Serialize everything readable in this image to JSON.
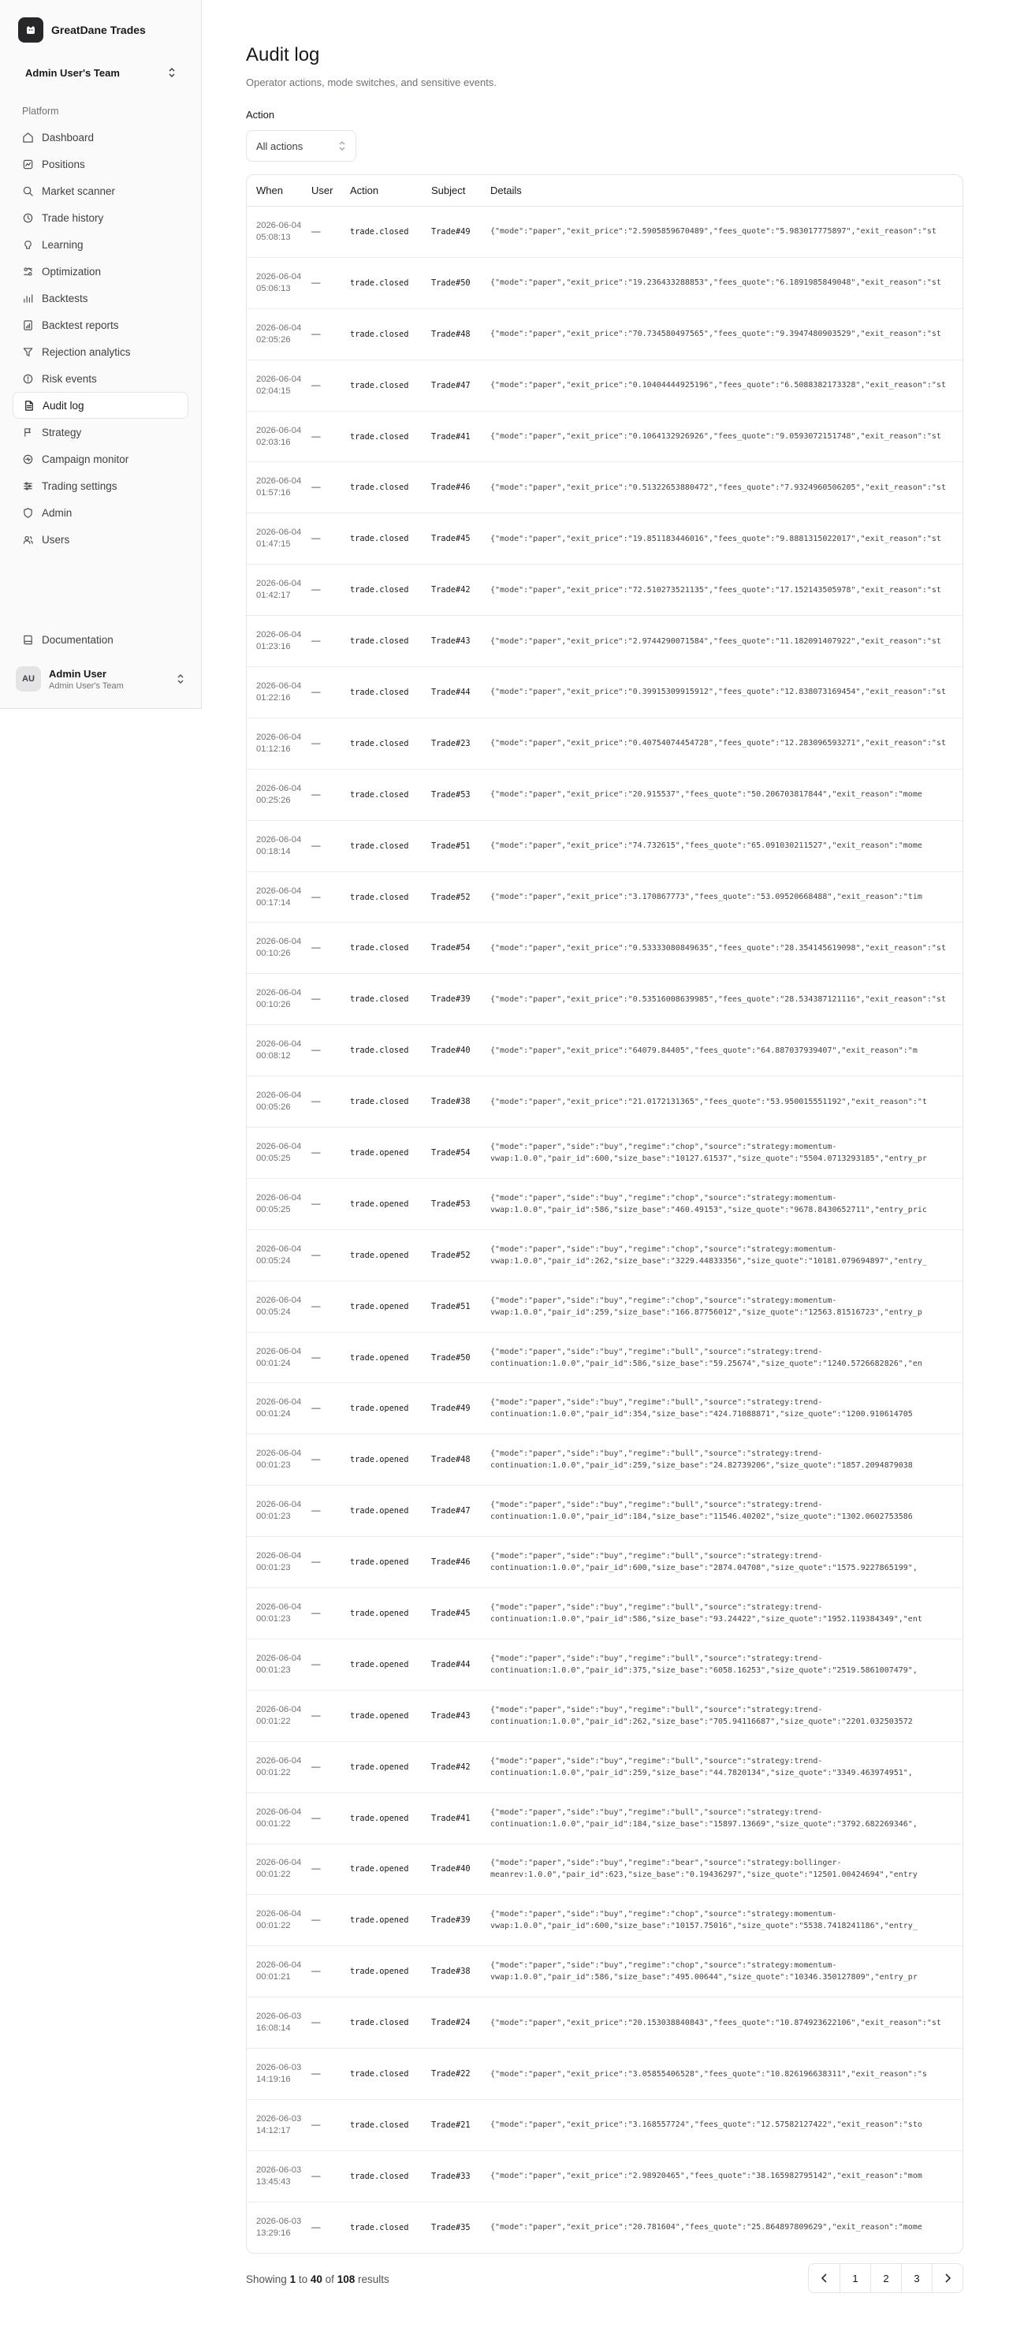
{
  "app": {
    "name": "GreatDane Trades",
    "team": "Admin User's Team"
  },
  "sidebar": {
    "section": "Platform",
    "items": [
      {
        "label": "Dashboard",
        "icon": "dashboard-icon",
        "active": false
      },
      {
        "label": "Positions",
        "icon": "positions-icon",
        "active": false
      },
      {
        "label": "Market scanner",
        "icon": "search-icon",
        "active": false
      },
      {
        "label": "Trade history",
        "icon": "history-icon",
        "active": false
      },
      {
        "label": "Learning",
        "icon": "learning-icon",
        "active": false
      },
      {
        "label": "Optimization",
        "icon": "optimization-icon",
        "active": false
      },
      {
        "label": "Backtests",
        "icon": "bar-chart-icon",
        "active": false
      },
      {
        "label": "Backtest reports",
        "icon": "report-icon",
        "active": false
      },
      {
        "label": "Rejection analytics",
        "icon": "filter-icon",
        "active": false
      },
      {
        "label": "Risk events",
        "icon": "alert-icon",
        "active": false
      },
      {
        "label": "Audit log",
        "icon": "document-icon",
        "active": true
      },
      {
        "label": "Strategy",
        "icon": "strategy-icon",
        "active": false
      },
      {
        "label": "Campaign monitor",
        "icon": "monitor-icon",
        "active": false
      },
      {
        "label": "Trading settings",
        "icon": "sliders-icon",
        "active": false
      },
      {
        "label": "Admin",
        "icon": "shield-icon",
        "active": false
      },
      {
        "label": "Users",
        "icon": "users-icon",
        "active": false
      }
    ],
    "documentation": "Documentation",
    "user": {
      "initials": "AU",
      "name": "Admin User",
      "team": "Admin User's Team"
    }
  },
  "page": {
    "title": "Audit log",
    "subtitle": "Operator actions, mode switches, and sensitive events.",
    "filter_label": "Action",
    "filter_value": "All actions"
  },
  "table": {
    "headers": {
      "when": "When",
      "user": "User",
      "action": "Action",
      "subject": "Subject",
      "details": "Details"
    },
    "rows": [
      {
        "date": "2026-06-04",
        "time": "05:08:13",
        "user": "—",
        "action": "trade.closed",
        "subject": "Trade#49",
        "details": [
          "{\"mode\":\"paper\",\"exit_price\":\"2.5905859670489\",\"fees_quote\":\"5.983017775897\",\"exit_reason\":\"st"
        ]
      },
      {
        "date": "2026-06-04",
        "time": "05:06:13",
        "user": "—",
        "action": "trade.closed",
        "subject": "Trade#50",
        "details": [
          "{\"mode\":\"paper\",\"exit_price\":\"19.236433288853\",\"fees_quote\":\"6.1891985849048\",\"exit_reason\":\"st"
        ]
      },
      {
        "date": "2026-06-04",
        "time": "02:05:26",
        "user": "—",
        "action": "trade.closed",
        "subject": "Trade#48",
        "details": [
          "{\"mode\":\"paper\",\"exit_price\":\"70.734580497565\",\"fees_quote\":\"9.3947480903529\",\"exit_reason\":\"st"
        ]
      },
      {
        "date": "2026-06-04",
        "time": "02:04:15",
        "user": "—",
        "action": "trade.closed",
        "subject": "Trade#47",
        "details": [
          "{\"mode\":\"paper\",\"exit_price\":\"0.10404444925196\",\"fees_quote\":\"6.5088382173328\",\"exit_reason\":\"st"
        ]
      },
      {
        "date": "2026-06-04",
        "time": "02:03:16",
        "user": "—",
        "action": "trade.closed",
        "subject": "Trade#41",
        "details": [
          "{\"mode\":\"paper\",\"exit_price\":\"0.1064132926926\",\"fees_quote\":\"9.0593072151748\",\"exit_reason\":\"st"
        ]
      },
      {
        "date": "2026-06-04",
        "time": "01:57:16",
        "user": "—",
        "action": "trade.closed",
        "subject": "Trade#46",
        "details": [
          "{\"mode\":\"paper\",\"exit_price\":\"0.51322653880472\",\"fees_quote\":\"7.9324960506205\",\"exit_reason\":\"st"
        ]
      },
      {
        "date": "2026-06-04",
        "time": "01:47:15",
        "user": "—",
        "action": "trade.closed",
        "subject": "Trade#45",
        "details": [
          "{\"mode\":\"paper\",\"exit_price\":\"19.851183446016\",\"fees_quote\":\"9.8881315022017\",\"exit_reason\":\"st"
        ]
      },
      {
        "date": "2026-06-04",
        "time": "01:42:17",
        "user": "—",
        "action": "trade.closed",
        "subject": "Trade#42",
        "details": [
          "{\"mode\":\"paper\",\"exit_price\":\"72.510273521135\",\"fees_quote\":\"17.152143505978\",\"exit_reason\":\"st"
        ]
      },
      {
        "date": "2026-06-04",
        "time": "01:23:16",
        "user": "—",
        "action": "trade.closed",
        "subject": "Trade#43",
        "details": [
          "{\"mode\":\"paper\",\"exit_price\":\"2.9744290071584\",\"fees_quote\":\"11.182091407922\",\"exit_reason\":\"st"
        ]
      },
      {
        "date": "2026-06-04",
        "time": "01:22:16",
        "user": "—",
        "action": "trade.closed",
        "subject": "Trade#44",
        "details": [
          "{\"mode\":\"paper\",\"exit_price\":\"0.39915309915912\",\"fees_quote\":\"12.838073169454\",\"exit_reason\":\"st"
        ]
      },
      {
        "date": "2026-06-04",
        "time": "01:12:16",
        "user": "—",
        "action": "trade.closed",
        "subject": "Trade#23",
        "details": [
          "{\"mode\":\"paper\",\"exit_price\":\"0.40754074454728\",\"fees_quote\":\"12.283096593271\",\"exit_reason\":\"st"
        ]
      },
      {
        "date": "2026-06-04",
        "time": "00:25:26",
        "user": "—",
        "action": "trade.closed",
        "subject": "Trade#53",
        "details": [
          "{\"mode\":\"paper\",\"exit_price\":\"20.915537\",\"fees_quote\":\"50.206703817844\",\"exit_reason\":\"mome"
        ]
      },
      {
        "date": "2026-06-04",
        "time": "00:18:14",
        "user": "—",
        "action": "trade.closed",
        "subject": "Trade#51",
        "details": [
          "{\"mode\":\"paper\",\"exit_price\":\"74.732615\",\"fees_quote\":\"65.091030211527\",\"exit_reason\":\"mome"
        ]
      },
      {
        "date": "2026-06-04",
        "time": "00:17:14",
        "user": "—",
        "action": "trade.closed",
        "subject": "Trade#52",
        "details": [
          "{\"mode\":\"paper\",\"exit_price\":\"3.170867773\",\"fees_quote\":\"53.09520668488\",\"exit_reason\":\"tim"
        ]
      },
      {
        "date": "2026-06-04",
        "time": "00:10:26",
        "user": "—",
        "action": "trade.closed",
        "subject": "Trade#54",
        "details": [
          "{\"mode\":\"paper\",\"exit_price\":\"0.53333080849635\",\"fees_quote\":\"28.354145619098\",\"exit_reason\":\"st"
        ]
      },
      {
        "date": "2026-06-04",
        "time": "00:10:26",
        "user": "—",
        "action": "trade.closed",
        "subject": "Trade#39",
        "details": [
          "{\"mode\":\"paper\",\"exit_price\":\"0.53516008639985\",\"fees_quote\":\"28.534387121116\",\"exit_reason\":\"st"
        ]
      },
      {
        "date": "2026-06-04",
        "time": "00:08:12",
        "user": "—",
        "action": "trade.closed",
        "subject": "Trade#40",
        "details": [
          "{\"mode\":\"paper\",\"exit_price\":\"64079.84405\",\"fees_quote\":\"64.887037939407\",\"exit_reason\":\"m"
        ]
      },
      {
        "date": "2026-06-04",
        "time": "00:05:26",
        "user": "—",
        "action": "trade.closed",
        "subject": "Trade#38",
        "details": [
          "{\"mode\":\"paper\",\"exit_price\":\"21.0172131365\",\"fees_quote\":\"53.950015551192\",\"exit_reason\":\"t"
        ]
      },
      {
        "date": "2026-06-04",
        "time": "00:05:25",
        "user": "—",
        "action": "trade.opened",
        "subject": "Trade#54",
        "details": [
          "{\"mode\":\"paper\",\"side\":\"buy\",\"regime\":\"chop\",\"source\":\"strategy:momentum-",
          "vwap:1.0.0\",\"pair_id\":600,\"size_base\":\"10127.61537\",\"size_quote\":\"5504.0713293185\",\"entry_pr"
        ]
      },
      {
        "date": "2026-06-04",
        "time": "00:05:25",
        "user": "—",
        "action": "trade.opened",
        "subject": "Trade#53",
        "details": [
          "{\"mode\":\"paper\",\"side\":\"buy\",\"regime\":\"chop\",\"source\":\"strategy:momentum-",
          "vwap:1.0.0\",\"pair_id\":586,\"size_base\":\"460.49153\",\"size_quote\":\"9678.8430652711\",\"entry_pric"
        ]
      },
      {
        "date": "2026-06-04",
        "time": "00:05:24",
        "user": "—",
        "action": "trade.opened",
        "subject": "Trade#52",
        "details": [
          "{\"mode\":\"paper\",\"side\":\"buy\",\"regime\":\"chop\",\"source\":\"strategy:momentum-",
          "vwap:1.0.0\",\"pair_id\":262,\"size_base\":\"3229.44833356\",\"size_quote\":\"10181.079694897\",\"entry_"
        ]
      },
      {
        "date": "2026-06-04",
        "time": "00:05:24",
        "user": "—",
        "action": "trade.opened",
        "subject": "Trade#51",
        "details": [
          "{\"mode\":\"paper\",\"side\":\"buy\",\"regime\":\"chop\",\"source\":\"strategy:momentum-",
          "vwap:1.0.0\",\"pair_id\":259,\"size_base\":\"166.87756012\",\"size_quote\":\"12563.81516723\",\"entry_p"
        ]
      },
      {
        "date": "2026-06-04",
        "time": "00:01:24",
        "user": "—",
        "action": "trade.opened",
        "subject": "Trade#50",
        "details": [
          "{\"mode\":\"paper\",\"side\":\"buy\",\"regime\":\"bull\",\"source\":\"strategy:trend-",
          "continuation:1.0.0\",\"pair_id\":586,\"size_base\":\"59.25674\",\"size_quote\":\"1240.5726682826\",\"en"
        ]
      },
      {
        "date": "2026-06-04",
        "time": "00:01:24",
        "user": "—",
        "action": "trade.opened",
        "subject": "Trade#49",
        "details": [
          "{\"mode\":\"paper\",\"side\":\"buy\",\"regime\":\"bull\",\"source\":\"strategy:trend-",
          "continuation:1.0.0\",\"pair_id\":354,\"size_base\":\"424.71088871\",\"size_quote\":\"1200.910614705"
        ]
      },
      {
        "date": "2026-06-04",
        "time": "00:01:23",
        "user": "—",
        "action": "trade.opened",
        "subject": "Trade#48",
        "details": [
          "{\"mode\":\"paper\",\"side\":\"buy\",\"regime\":\"bull\",\"source\":\"strategy:trend-",
          "continuation:1.0.0\",\"pair_id\":259,\"size_base\":\"24.82739206\",\"size_quote\":\"1857.2094879038"
        ]
      },
      {
        "date": "2026-06-04",
        "time": "00:01:23",
        "user": "—",
        "action": "trade.opened",
        "subject": "Trade#47",
        "details": [
          "{\"mode\":\"paper\",\"side\":\"buy\",\"regime\":\"bull\",\"source\":\"strategy:trend-",
          "continuation:1.0.0\",\"pair_id\":184,\"size_base\":\"11546.40202\",\"size_quote\":\"1302.0602753586"
        ]
      },
      {
        "date": "2026-06-04",
        "time": "00:01:23",
        "user": "—",
        "action": "trade.opened",
        "subject": "Trade#46",
        "details": [
          "{\"mode\":\"paper\",\"side\":\"buy\",\"regime\":\"bull\",\"source\":\"strategy:trend-",
          "continuation:1.0.0\",\"pair_id\":600,\"size_base\":\"2874.04708\",\"size_quote\":\"1575.9227865199\","
        ]
      },
      {
        "date": "2026-06-04",
        "time": "00:01:23",
        "user": "—",
        "action": "trade.opened",
        "subject": "Trade#45",
        "details": [
          "{\"mode\":\"paper\",\"side\":\"buy\",\"regime\":\"bull\",\"source\":\"strategy:trend-",
          "continuation:1.0.0\",\"pair_id\":586,\"size_base\":\"93.24422\",\"size_quote\":\"1952.119384349\",\"ent"
        ]
      },
      {
        "date": "2026-06-04",
        "time": "00:01:23",
        "user": "—",
        "action": "trade.opened",
        "subject": "Trade#44",
        "details": [
          "{\"mode\":\"paper\",\"side\":\"buy\",\"regime\":\"bull\",\"source\":\"strategy:trend-",
          "continuation:1.0.0\",\"pair_id\":375,\"size_base\":\"6058.16253\",\"size_quote\":\"2519.5861007479\","
        ]
      },
      {
        "date": "2026-06-04",
        "time": "00:01:22",
        "user": "—",
        "action": "trade.opened",
        "subject": "Trade#43",
        "details": [
          "{\"mode\":\"paper\",\"side\":\"buy\",\"regime\":\"bull\",\"source\":\"strategy:trend-",
          "continuation:1.0.0\",\"pair_id\":262,\"size_base\":\"705.94116687\",\"size_quote\":\"2201.032503572"
        ]
      },
      {
        "date": "2026-06-04",
        "time": "00:01:22",
        "user": "—",
        "action": "trade.opened",
        "subject": "Trade#42",
        "details": [
          "{\"mode\":\"paper\",\"side\":\"buy\",\"regime\":\"bull\",\"source\":\"strategy:trend-",
          "continuation:1.0.0\",\"pair_id\":259,\"size_base\":\"44.7820134\",\"size_quote\":\"3349.463974951\","
        ]
      },
      {
        "date": "2026-06-04",
        "time": "00:01:22",
        "user": "—",
        "action": "trade.opened",
        "subject": "Trade#41",
        "details": [
          "{\"mode\":\"paper\",\"side\":\"buy\",\"regime\":\"bull\",\"source\":\"strategy:trend-",
          "continuation:1.0.0\",\"pair_id\":184,\"size_base\":\"15897.13669\",\"size_quote\":\"3792.682269346\","
        ]
      },
      {
        "date": "2026-06-04",
        "time": "00:01:22",
        "user": "—",
        "action": "trade.opened",
        "subject": "Trade#40",
        "details": [
          "{\"mode\":\"paper\",\"side\":\"buy\",\"regime\":\"bear\",\"source\":\"strategy:bollinger-",
          "meanrev:1.0.0\",\"pair_id\":623,\"size_base\":\"0.19436297\",\"size_quote\":\"12501.00424694\",\"entry"
        ]
      },
      {
        "date": "2026-06-04",
        "time": "00:01:22",
        "user": "—",
        "action": "trade.opened",
        "subject": "Trade#39",
        "details": [
          "{\"mode\":\"paper\",\"side\":\"buy\",\"regime\":\"chop\",\"source\":\"strategy:momentum-",
          "vwap:1.0.0\",\"pair_id\":600,\"size_base\":\"10157.75016\",\"size_quote\":\"5538.7418241186\",\"entry_"
        ]
      },
      {
        "date": "2026-06-04",
        "time": "00:01:21",
        "user": "—",
        "action": "trade.opened",
        "subject": "Trade#38",
        "details": [
          "{\"mode\":\"paper\",\"side\":\"buy\",\"regime\":\"chop\",\"source\":\"strategy:momentum-",
          "vwap:1.0.0\",\"pair_id\":586,\"size_base\":\"495.00644\",\"size_quote\":\"10346.350127809\",\"entry_pr"
        ]
      },
      {
        "date": "2026-06-03",
        "time": "16:08:14",
        "user": "—",
        "action": "trade.closed",
        "subject": "Trade#24",
        "details": [
          "{\"mode\":\"paper\",\"exit_price\":\"20.153038840843\",\"fees_quote\":\"10.874923622106\",\"exit_reason\":\"st"
        ]
      },
      {
        "date": "2026-06-03",
        "time": "14:19:16",
        "user": "—",
        "action": "trade.closed",
        "subject": "Trade#22",
        "details": [
          "{\"mode\":\"paper\",\"exit_price\":\"3.05855406528\",\"fees_quote\":\"10.826196638311\",\"exit_reason\":\"s"
        ]
      },
      {
        "date": "2026-06-03",
        "time": "14:12:17",
        "user": "—",
        "action": "trade.closed",
        "subject": "Trade#21",
        "details": [
          "{\"mode\":\"paper\",\"exit_price\":\"3.168557724\",\"fees_quote\":\"12.57582127422\",\"exit_reason\":\"sto"
        ]
      },
      {
        "date": "2026-06-03",
        "time": "13:45:43",
        "user": "—",
        "action": "trade.closed",
        "subject": "Trade#33",
        "details": [
          "{\"mode\":\"paper\",\"exit_price\":\"2.98920465\",\"fees_quote\":\"38.165982795142\",\"exit_reason\":\"mom"
        ]
      },
      {
        "date": "2026-06-03",
        "time": "13:29:16",
        "user": "—",
        "action": "trade.closed",
        "subject": "Trade#35",
        "details": [
          "{\"mode\":\"paper\",\"exit_price\":\"20.781604\",\"fees_quote\":\"25.864897809629\",\"exit_reason\":\"mome"
        ]
      }
    ]
  },
  "footer": {
    "prefix": "Showing",
    "from": "1",
    "to_word": "to",
    "to": "40",
    "of_word": "of",
    "total": "108",
    "suffix": "results",
    "pages": [
      "1",
      "2",
      "3"
    ]
  }
}
